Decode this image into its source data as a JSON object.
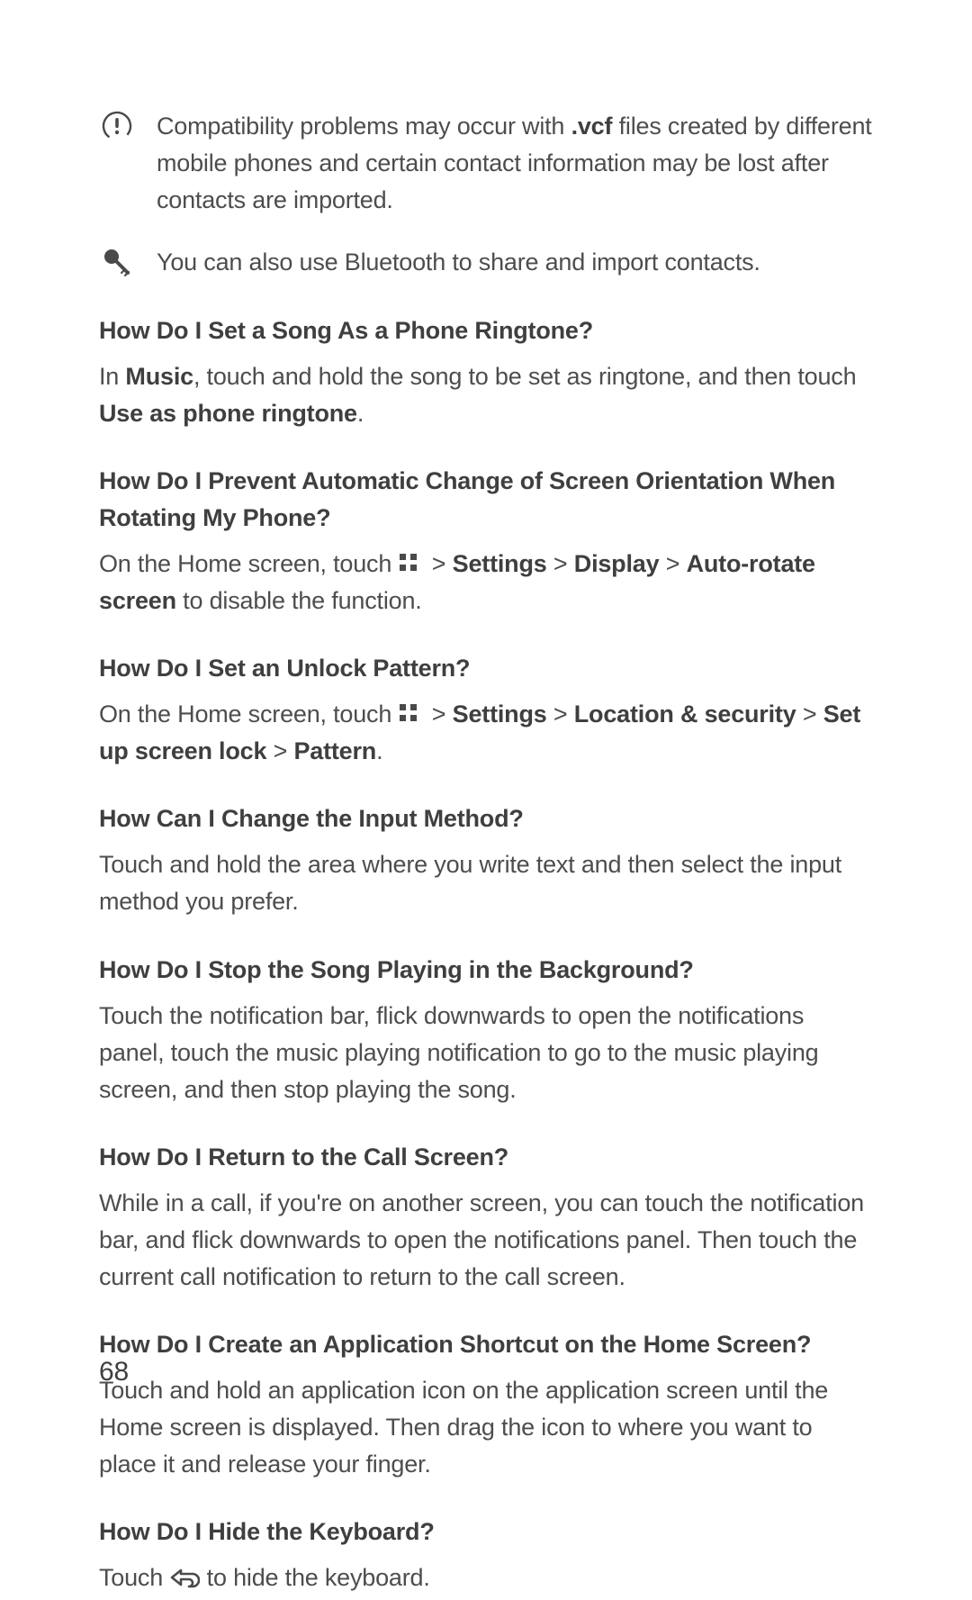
{
  "note_warning": {
    "pre": "Compatibility problems may occur with ",
    "bold": ".vcf",
    "post": " files created by different mobile phones and certain contact information may be lost after contacts are imported."
  },
  "note_tip": "You can also use Bluetooth to share and import contacts.",
  "q1_title": "How Do I Set a Song As a Phone Ringtone?",
  "q1": {
    "t0": "In ",
    "b0": "Music",
    "t1": ", touch and hold the song to be set as ringtone, and then touch ",
    "b1": "Use as phone ringtone",
    "t2": "."
  },
  "q2_title": "How Do I Prevent Automatic Change of Screen Orientation When Rotating My Phone?",
  "q2": {
    "t0": "On the Home screen, touch ",
    "t1": " > ",
    "b0": "Settings",
    "t2": " > ",
    "b1": "Display",
    "t3": " > ",
    "b2": "Auto-rotate screen",
    "t4": " to disable the function."
  },
  "q3_title": "How Do I Set an Unlock Pattern?",
  "q3": {
    "t0": "On the Home screen, touch ",
    "t1": " > ",
    "b0": "Settings",
    "t2": " > ",
    "b1": "Location & security",
    "t3": " > ",
    "b2": "Set up screen lock",
    "t4": " > ",
    "b3": "Pattern",
    "t5": "."
  },
  "q4_title": "How Can I Change the Input Method?",
  "q4_body": "Touch and hold the area where you write text and then select the input method you prefer.",
  "q5_title": "How Do I Stop the Song Playing in the Background?",
  "q5_body": "Touch the notification bar, flick downwards to open the notifications panel, touch the music playing notification to go to the music playing screen, and then stop playing the song.",
  "q6_title": "How Do I Return to the Call Screen?",
  "q6_body": "While in a call, if you're on another screen, you can touch the notification bar, and flick downwards to open the notifications panel. Then touch the current call notification to return to the call screen.",
  "q7_title": "How Do I Create an Application Shortcut on the Home Screen?",
  "q7_body": "Touch and hold an application icon on the application screen until the Home screen is displayed. Then drag the icon to where you want to place it and release your finger.",
  "q8_title": "How Do I Hide the Keyboard?",
  "q8": {
    "t0": "Touch ",
    "t1": " to hide the keyboard."
  },
  "page_number": "68"
}
